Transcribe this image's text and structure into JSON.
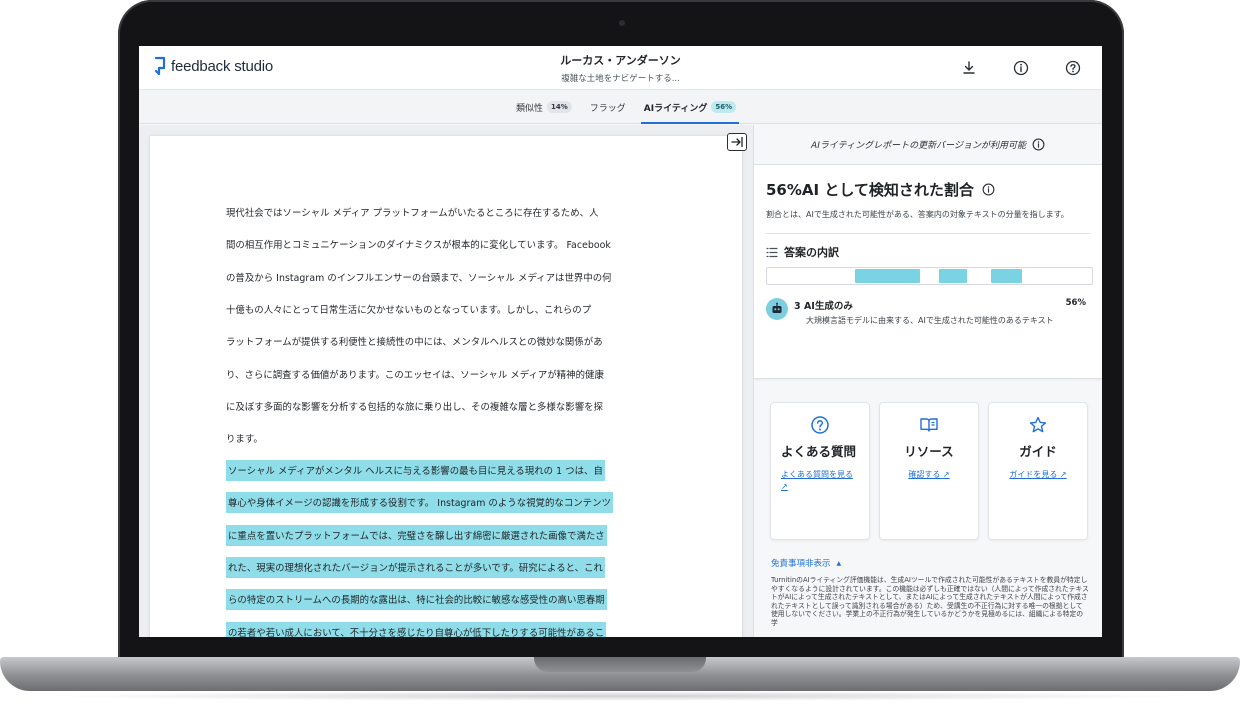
{
  "app": {
    "logo_text": "feedback studio",
    "student_name": "ルーカス・アンダーソン",
    "paper_title": "複雑な土地をナビゲートする..."
  },
  "header_icons": [
    "download-icon",
    "info-icon",
    "help-icon"
  ],
  "tabs": [
    {
      "label": "類似性",
      "badge": "14%"
    },
    {
      "label": "フラッグ",
      "badge": ""
    },
    {
      "label": "AIライティング",
      "badge": "56%"
    }
  ],
  "document": {
    "lines": [
      {
        "text": "現代社会ではソーシャル メディア プラットフォームがいたるところに存在するため、人",
        "highlight": false
      },
      {
        "text": "間の相互作用とコミュニケーションのダイナミクスが根本的に変化しています。 Facebook",
        "highlight": false
      },
      {
        "text": "の普及から Instagram のインフルエンサーの台頭まで、ソーシャル メディアは世界中の何",
        "highlight": false
      },
      {
        "text": "十億もの人々にとって日常生活に欠かせないものとなっています。しかし、これらのプ",
        "highlight": false
      },
      {
        "text": "ラットフォームが提供する利便性と接続性の中には、メンタルヘルスとの微妙な関係があ",
        "highlight": false
      },
      {
        "text": "り、さらに調査する価値があります。このエッセイは、ソーシャル メディアが精神的健康",
        "highlight": false
      },
      {
        "text": "に及ぼす多面的な影響を分析する包括的な旅に乗り出し、その複雑な層と多様な影響を探",
        "highlight": false
      },
      {
        "text": "ります。",
        "highlight": false
      },
      {
        "text": "ソーシャル メディアがメンタル ヘルスに与える影響の最も目に見える現れの 1 つは、自",
        "highlight": true
      },
      {
        "text": "尊心や身体イメージの認識を形成する役割です。 Instagram のような視覚的なコンテンツ",
        "highlight": true
      },
      {
        "text": "に重点を置いたプラットフォームでは、完璧さを醸し出す綿密に厳選された画像で満たさ",
        "highlight": true
      },
      {
        "text": "れた、現実の理想化されたバージョンが提示されることが多いです。研究によると、これ",
        "highlight": true
      },
      {
        "text": "らの特定のストリームへの長期的な露出は、特に社会的比較に敏感な感受性の高い思春期",
        "highlight": true
      },
      {
        "text": "の若者や若い成人において、不十分さを感じたり自尊心が低下したりする可能性があるこ",
        "highlight": true
      }
    ]
  },
  "panel": {
    "update_notice": "AIライティングレポートの更新バージョンが利用可能",
    "headline": "56%AI として検知された割合",
    "description": "割合とは、AIで生成された可能性がある、答案内の対象テキストの分量を指します。",
    "breakdown_title": "答案の内訳",
    "breakdown_segments": [
      {
        "start": 0.27,
        "end": 0.47
      },
      {
        "start": 0.53,
        "end": 0.615
      },
      {
        "start": 0.69,
        "end": 0.785
      }
    ],
    "ai_row": {
      "count": "3",
      "label": "AI生成のみ",
      "percent": "56%",
      "subtext": "大規模言語モデルに由来する、AIで生成された可能性のあるテキスト"
    },
    "cards": [
      {
        "icon": "question-icon",
        "title": "よくある質問",
        "link": "よくある質問を見る"
      },
      {
        "icon": "book-icon",
        "title": "リソース",
        "link": "確認する"
      },
      {
        "icon": "star-icon",
        "title": "ガイド",
        "link": "ガイドを見る"
      }
    ],
    "disclaimer_toggle": "免責事項非表示",
    "disclaimer_text": "TurnitinのAIライティング評価機能は、生成AIツールで作成された可能性があるテキストを教員が特定しやすくなるように設計されています。この機能は必ずしも正確ではない（人間によって作成されたテキストがAIによって生成されたテキストとして、またはAIによって生成されたテキストが人間によって作成されたテキストとして誤って識別される場合がある）ため、受講生の不正行為に対する唯一の根拠として使用しないでください。学業上の不正行為が発生しているかどうかを見極めるには、組織による特定の学"
  }
}
